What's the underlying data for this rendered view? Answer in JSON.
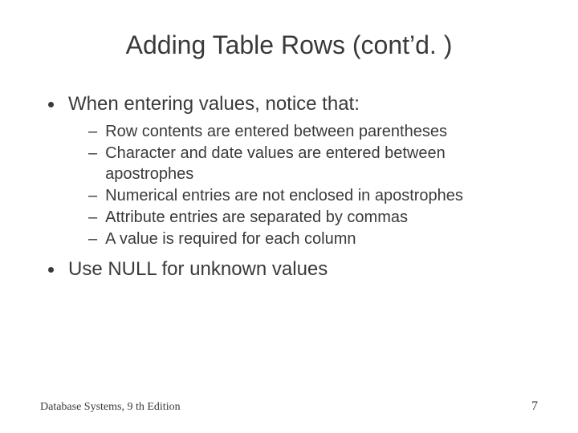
{
  "title": "Adding Table Rows (cont’d. )",
  "bullets": [
    {
      "text": "When entering values, notice that:",
      "subs": [
        "Row contents are entered between parentheses",
        "Character and date values are entered between apostrophes",
        "Numerical entries are not enclosed in apostrophes",
        "Attribute entries are separated by commas",
        "A value is required for each column"
      ]
    },
    {
      "text": "Use NULL for unknown values",
      "subs": []
    }
  ],
  "footer": {
    "left": "Database Systems, 9 th Edition",
    "right": "7"
  }
}
